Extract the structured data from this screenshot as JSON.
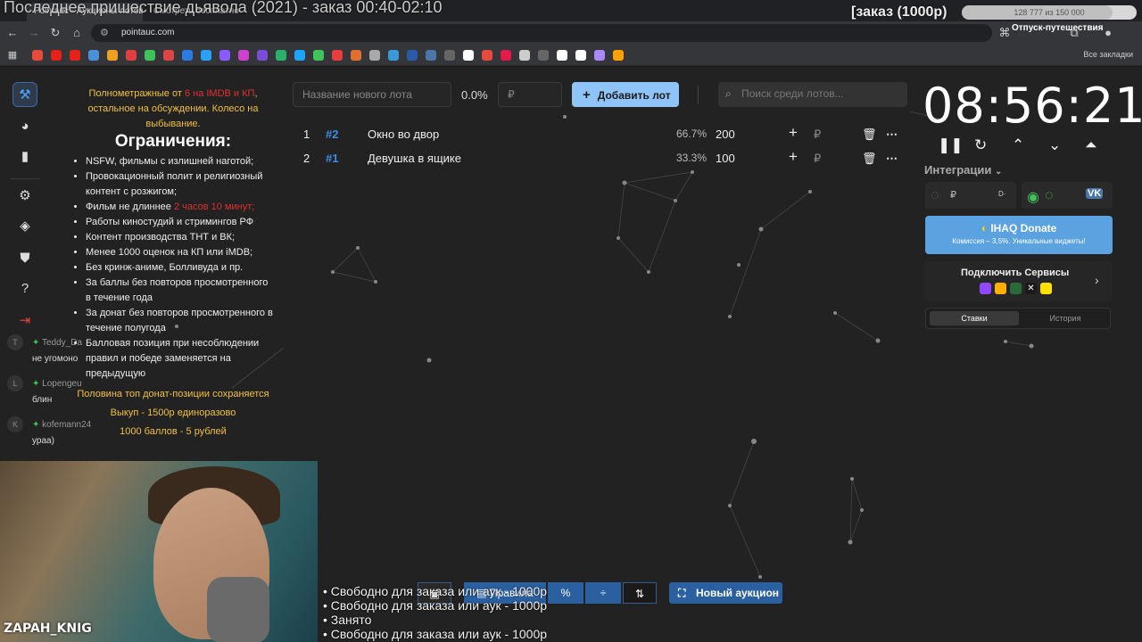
{
  "stream": {
    "title": "Последнее пришествие дьявола (2021) - заказ 00:40-02:10",
    "order_label": "[заказ (1000р)",
    "progress_text": "128 777 из 150 000",
    "progress_fraction": 0.86,
    "vacation_label": "Отпуск-путешествия"
  },
  "browser": {
    "tabs": [
      "Pointauc - Аукционы лотов",
      "Смотреть бесплатно"
    ],
    "url": "pointauc.com",
    "bookmarks_all": "Все закладки",
    "bookmark_colors": [
      "#e64a3c",
      "#e62117",
      "#e62117",
      "#4a90d9",
      "#f0a020",
      "#e04040",
      "#3ec45a",
      "#d44",
      "#2a7ae2",
      "#2aa0ff",
      "#8a5cff",
      "#d040d0",
      "#7a4dd8",
      "#2ab06a",
      "#1ca4ff",
      "#3ec45a",
      "#e63e3e",
      "#e07030",
      "#aaa",
      "#3a9ad9",
      "#2a5aa8",
      "#4a76a8",
      "#666",
      "#fff",
      "#e64a3c",
      "#e6194b",
      "#ccc",
      "#666",
      "#fff",
      "#fff",
      "#aa88ff",
      "#ffa000"
    ]
  },
  "rail": {
    "icons": [
      "gavel-icon",
      "wheel-icon",
      "stats-icon",
      "settings-icon",
      "layers-icon",
      "shield-icon",
      "help-icon",
      "logout-icon"
    ]
  },
  "rules": {
    "intro_start": "Полнометражные от ",
    "intro_red": "6 на IMDB и КП",
    "intro_end": ", остальное на обсуждении. Колесо на выбывание.",
    "heading": "Ограничения:",
    "items": [
      "NSFW, фильмы с излишней наготой;",
      "Провокационный полит и религиозный контент с розжигом;",
      "Фильм не длиннее ",
      "Работы киностудий и стримингов РФ",
      "Контент производства ТНТ и ВК;",
      "Менее 1000 оценок на КП или iMDB;",
      "Без кринж-аниме, Болливуда и пр.",
      "За баллы без повторов просмотренного в течение года",
      "За донат без повторов просмотренного в течение полугода",
      "Балловая позиция при несоблюдении правил и победе заменяется на предыдущую"
    ],
    "duration_red": "2 часов 10 минут;",
    "footer": [
      "Половина топ донат-позиции сохраняется",
      "Выкуп - 1500р единоразово",
      "1000 баллов - 5 рублей"
    ]
  },
  "chat": [
    {
      "avatar": "T",
      "name": "Teddy_Da",
      "text": "не угомоно"
    },
    {
      "avatar": "L",
      "name": "Lopengeu",
      "text": "блин"
    },
    {
      "avatar": "K",
      "name": "kofemann24",
      "text": "ураа)"
    }
  ],
  "lot_form": {
    "name_placeholder": "Название нового лота",
    "percent": "0.0%",
    "amount_placeholder": "₽",
    "add_button": "Добавить лот",
    "search_placeholder": "Поиск среди лотов..."
  },
  "lots": [
    {
      "index": "1",
      "id": "#2",
      "name": "Окно во двор",
      "percent": "66.7%",
      "amount": "200"
    },
    {
      "index": "2",
      "id": "#1",
      "name": "Девушка в ящике",
      "percent": "33.3%",
      "amount": "100"
    }
  ],
  "timer": {
    "display": "08:56:21",
    "integrations_label": "Интеграции",
    "donate_title": "IHAQ Donate",
    "donate_sub": "Комиссия – 3,5%. Уникальные виджеты!",
    "services_title": "Подключить Сервисы",
    "tab_bids": "Ставки",
    "tab_history": "История",
    "rub": "₽"
  },
  "bottom": {
    "rules_label": "Правила",
    "new_auction": "Новый аукцион"
  },
  "queue": [
    "• Свободно для заказа или аук - 1000р",
    "• Свободно для заказа или аук - 1000р",
    "• Занято",
    "• Свободно для заказа или аук - 1000р"
  ],
  "webcam": {
    "channel": "ZAPAH_KNIG"
  }
}
